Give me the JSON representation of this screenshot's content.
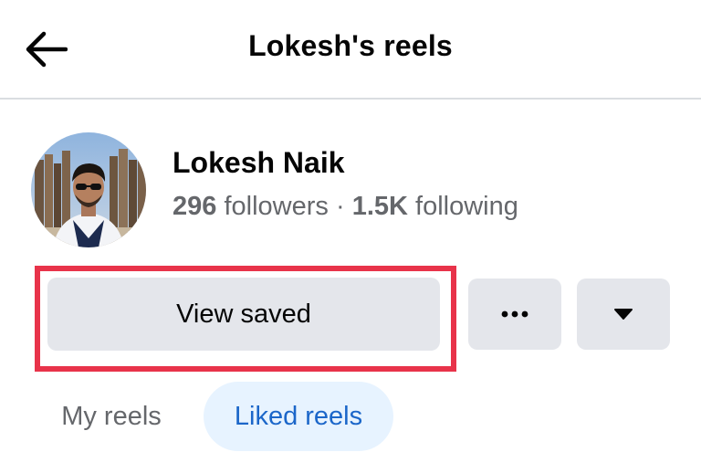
{
  "header": {
    "title": "Lokesh's reels"
  },
  "profile": {
    "name": "Lokesh Naik",
    "followers_count": "296",
    "followers_label": "followers",
    "separator": "·",
    "following_count": "1.5K",
    "following_label": "following"
  },
  "actions": {
    "view_saved_label": "View saved",
    "more_icon": "more-horizontal-icon",
    "dropdown_icon": "caret-down-icon"
  },
  "tabs": [
    {
      "label": "My reels",
      "active": false
    },
    {
      "label": "Liked reels",
      "active": true
    }
  ],
  "colors": {
    "highlight": "#e8334a",
    "button_bg": "#e4e6eb",
    "active_tab_bg": "#e7f3ff",
    "active_tab_text": "#1b66c9",
    "secondary_text": "#65676b"
  }
}
